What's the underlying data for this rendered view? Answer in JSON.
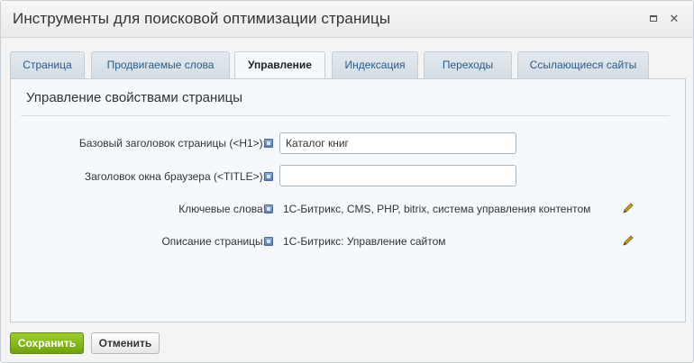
{
  "dialog": {
    "title": "Инструменты для поисковой оптимизации страницы"
  },
  "tabs": [
    {
      "label": "Страница",
      "active": false
    },
    {
      "label": "Продвигаемые слова",
      "active": false
    },
    {
      "label": "Управление",
      "active": true
    },
    {
      "label": "Индексация",
      "active": false
    },
    {
      "label": "Переходы",
      "active": false
    },
    {
      "label": "Ссылающиеся сайты",
      "active": false
    }
  ],
  "panel": {
    "section_title": "Управление свойствами страницы",
    "fields": {
      "h1": {
        "label": "Базовый заголовок страницы (<H1>):",
        "value": "Каталог книг"
      },
      "title": {
        "label": "Заголовок окна браузера (<TITLE>):",
        "value": ""
      },
      "keywords": {
        "label": "Ключевые слова:",
        "value": "1С-Битрикс, CMS, PHP, bitrix, система управления контентом"
      },
      "description": {
        "label": "Описание страницы:",
        "value": "1С-Битрикс: Управление сайтом"
      }
    }
  },
  "footer": {
    "save_label": "Сохранить",
    "cancel_label": "Отменить"
  },
  "colors": {
    "save_button": "#7fb31c",
    "tab_link": "#2a5b8a",
    "panel_bg": "#f5f9fb"
  }
}
